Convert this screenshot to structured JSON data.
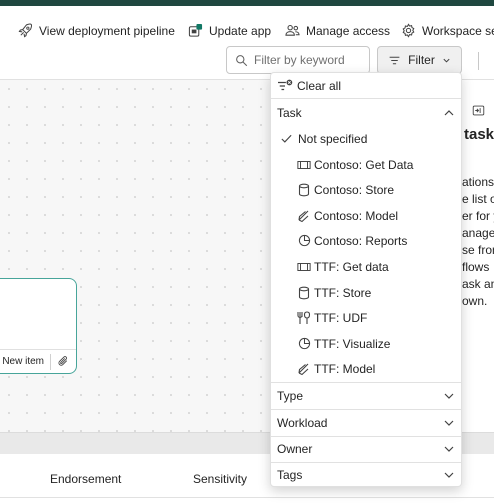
{
  "toolbar": {
    "view_pipeline": "View deployment pipeline",
    "update_app": "Update app",
    "manage_access": "Manage access",
    "workspace_settings": "Workspace set"
  },
  "search": {
    "placeholder": "Filter by keyword"
  },
  "filter_button": {
    "label": "Filter"
  },
  "canvas": {
    "node_new_item": "New item"
  },
  "side_panel": {
    "title": "task",
    "lines": [
      "ations",
      "e list o",
      "er for y",
      "anage",
      "se from",
      "flows",
      "ask an",
      "own."
    ]
  },
  "table_headers": {
    "endorsement": "Endorsement",
    "sensitivity": "Sensitivity"
  },
  "filter_menu": {
    "clear_all": "Clear all",
    "task_section": "Task",
    "task_options": [
      {
        "label": "Not specified",
        "icon": "checkmark-icon",
        "checked": true
      },
      {
        "label": "Contoso: Get Data",
        "icon": "get-data-icon"
      },
      {
        "label": "Contoso: Store",
        "icon": "database-icon"
      },
      {
        "label": "Contoso: Model",
        "icon": "model-icon"
      },
      {
        "label": "Contoso: Reports",
        "icon": "pie-chart-icon"
      },
      {
        "label": "TTF: Get data",
        "icon": "get-data-icon"
      },
      {
        "label": "TTF: Store",
        "icon": "database-icon"
      },
      {
        "label": "TTF: UDF",
        "icon": "tools-icon"
      },
      {
        "label": "TTF: Visualize",
        "icon": "pie-chart-icon"
      },
      {
        "label": "TTF: Model",
        "icon": "model-icon"
      }
    ],
    "sections": [
      "Type",
      "Workload",
      "Owner",
      "Tags"
    ]
  },
  "colors": {
    "accent_teal": "#47a59a",
    "top_bar": "#1f4740"
  }
}
